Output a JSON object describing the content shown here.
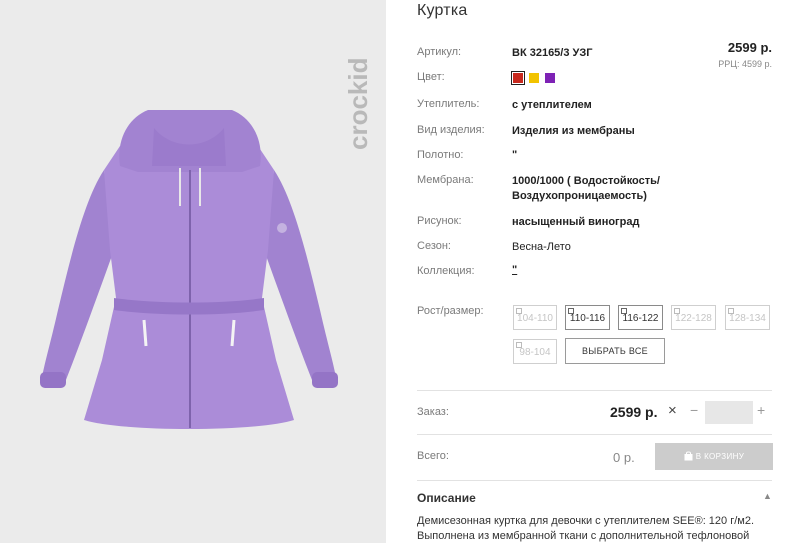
{
  "product": {
    "title": "Куртка",
    "price": "2599 р.",
    "rrp": "РРЦ: 4599 р."
  },
  "brand": {
    "name": "crockid"
  },
  "specs": [
    {
      "label": "Артикул:",
      "value": "ВК 32165/3 УЗГ"
    },
    {
      "label": "Цвет:",
      "value": ""
    },
    {
      "label": "Утеплитель:",
      "value": "с утеплителем"
    },
    {
      "label": "Вид изделия:",
      "value": "Изделия из мембраны"
    },
    {
      "label": "Полотно:",
      "value": "\""
    },
    {
      "label": "Мембрана:",
      "value": "1000/1000 ( Водостойкость/ Воздухопроницаемость)"
    },
    {
      "label": "Рисунок:",
      "value": "насыщенный виноград"
    },
    {
      "label": "Сезон:",
      "value": "Весна-Лето"
    },
    {
      "label": "Коллекция:",
      "value": "\""
    }
  ],
  "colors": [
    {
      "name": "red",
      "hex": "#c8281e",
      "selected": true
    },
    {
      "name": "yellow",
      "hex": "#f2c300",
      "selected": false
    },
    {
      "name": "purple",
      "hex": "#7e22b5",
      "selected": false
    }
  ],
  "sizes": {
    "label": "Рост/размер:",
    "options": [
      {
        "label": "104-110",
        "available": false
      },
      {
        "label": "110-116",
        "available": true
      },
      {
        "label": "116-122",
        "available": true
      },
      {
        "label": "122-128",
        "available": false
      },
      {
        "label": "128-134",
        "available": false
      },
      {
        "label": "98-104",
        "available": false
      }
    ],
    "select_all": "ВЫБРАТЬ ВСЕ"
  },
  "order": {
    "label": "Заказ:",
    "price": "2599 р.",
    "times": "×",
    "minus": "−",
    "plus": "+",
    "quantity": ""
  },
  "total": {
    "label": "Всего:",
    "price": "0 р.",
    "cart_button": "В КОРЗИНУ"
  },
  "description": {
    "title": "Описание",
    "chevron": "▲",
    "text": "Демисезонная куртка для девочки с утеплителем SEE®: 120 г/м2. Выполнена из мембранной ткани с дополнительной тефлоновой"
  },
  "icons": {
    "logo": "crockid-logo",
    "cart": "shopping-bag-icon",
    "size_marker": "checkbox-corner-icon"
  },
  "accent_colors": {
    "photo_bg": "#ebebeb",
    "jacket": "#a98ad6",
    "cart_disabled": "#cccccc"
  }
}
